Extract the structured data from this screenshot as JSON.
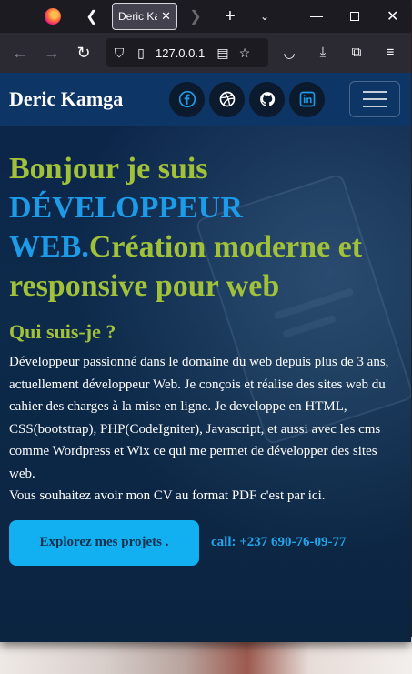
{
  "browser": {
    "tab": {
      "title": "Deric Kamga",
      "close_glyph": "✕"
    },
    "tabstrip": {
      "back_glyph": "❮",
      "forward_glyph": "❯",
      "new_tab_glyph": "+",
      "list_glyph": "⌄",
      "close_glyph": "✕"
    },
    "nav": {
      "back_glyph": "←",
      "forward_glyph": "→",
      "reload_glyph": "↻",
      "url": "127.0.0.1",
      "shield_glyph": "⛉",
      "page_glyph": "▯",
      "reader_glyph": "▤",
      "star_glyph": "☆",
      "pocket_glyph": "◡",
      "download_glyph": "⤓",
      "extensions_glyph": "⧉",
      "menu_glyph": "≡"
    }
  },
  "site": {
    "brand": "Deric Kamga",
    "socials": [
      {
        "name": "facebook"
      },
      {
        "name": "dribbble"
      },
      {
        "name": "github"
      },
      {
        "name": "linkedin"
      }
    ],
    "hero": {
      "title_prefix": "Bonjour je suis",
      "role": "DÉVELOPPEUR WEB.",
      "title_suffix": "Création moderne et responsive pour web"
    },
    "about": {
      "heading": "Qui suis-je ?",
      "paragraph": "Développeur passionné dans le domaine du web depuis plus de 3 ans, actuellement développeur Web. Je conçois et réalise des sites web du cahier des charges à la mise en ligne. Je developpe en HTML, CSS(bootstrap), PHP(CodeIgniter), Javascript, et aussi avec les cms comme Wordpress et Wix ce qui me permet de développer des sites web.",
      "cv_line": "Vous souhaitez avoir mon CV au format PDF c'est par ici."
    },
    "cta": {
      "projects_label": "Explorez mes projets .",
      "call_label": "call: +237 690-76-09-77"
    },
    "colors": {
      "accent_green": "#a2c13a",
      "accent_blue": "#1e9be8",
      "button": "#12b0f0"
    }
  }
}
